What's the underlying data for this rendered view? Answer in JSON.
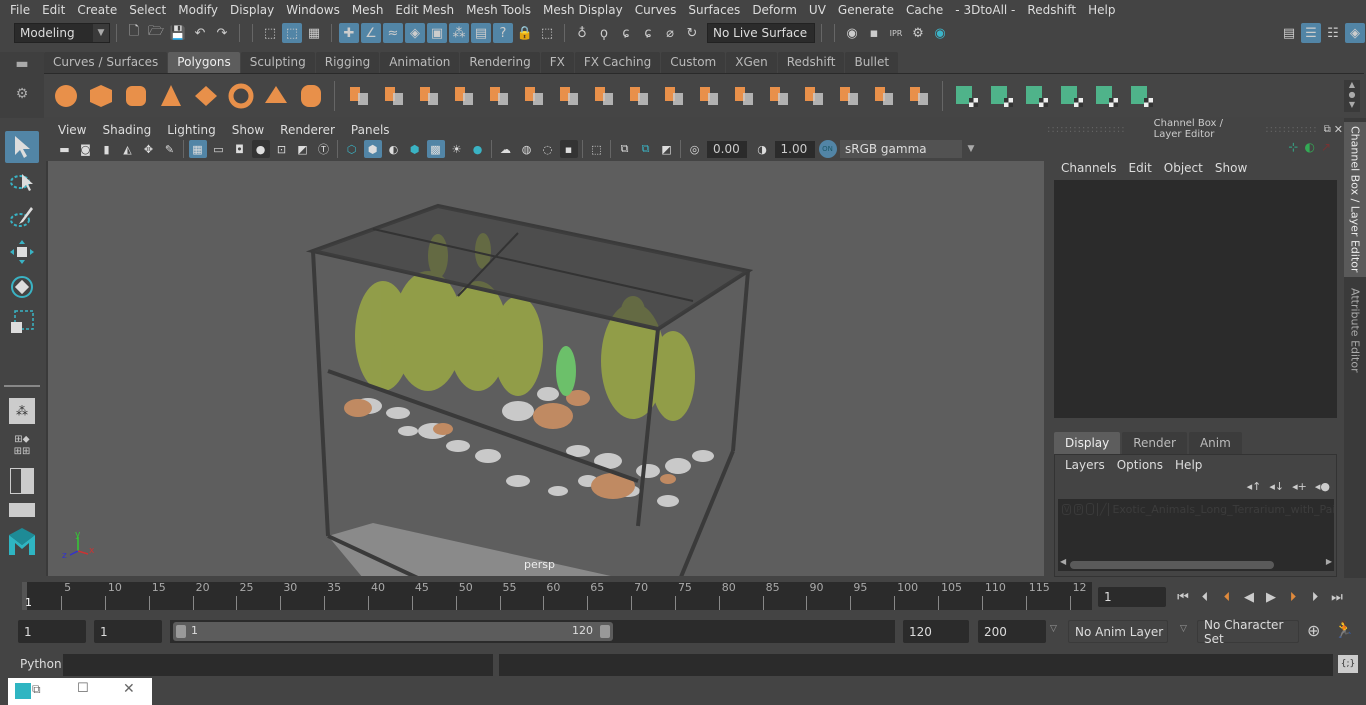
{
  "menubar": {
    "items": [
      "File",
      "Edit",
      "Create",
      "Select",
      "Modify",
      "Display",
      "Windows",
      "Mesh",
      "Edit Mesh",
      "Mesh Tools",
      "Mesh Display",
      "Curves",
      "Surfaces",
      "Deform",
      "UV",
      "Generate",
      "Cache",
      "- 3DtoAll -",
      "Redshift",
      "Help"
    ]
  },
  "statusline": {
    "mode": "Modeling",
    "live_surface": "No Live Surface"
  },
  "shelf": {
    "tabs": [
      "Curves / Surfaces",
      "Polygons",
      "Sculpting",
      "Rigging",
      "Animation",
      "Rendering",
      "FX",
      "FX Caching",
      "Custom",
      "XGen",
      "Redshift",
      "Bullet"
    ],
    "active_tab": "Polygons",
    "icons": [
      "poly-sphere",
      "poly-cube",
      "poly-cylinder",
      "poly-cone",
      "poly-plane",
      "poly-torus",
      "poly-pyramid",
      "poly-pipe",
      "combine",
      "separate",
      "mirror",
      "smooth",
      "extract",
      "boolean",
      "multi-cut",
      "extrude",
      "bevel",
      "bridge",
      "append",
      "insert-edge-loop",
      "offset-edge-loop",
      "fill-hole",
      "target-weld",
      "reduce",
      "planar-uv",
      "cylindrical-uv",
      "spherical-uv",
      "automatic-uv",
      "unfold-uv",
      "uv-editor",
      "layout-uv"
    ]
  },
  "viewport": {
    "menu": [
      "View",
      "Shading",
      "Lighting",
      "Show",
      "Renderer",
      "Panels"
    ],
    "exposure": "0.00",
    "gamma": "1.00",
    "color_space": "sRGB gamma",
    "camera_label": "persp",
    "axis": {
      "x": "x",
      "y": "y",
      "z": "z"
    }
  },
  "channel_box": {
    "title": "Channel Box / Layer Editor",
    "menu": [
      "Channels",
      "Edit",
      "Object",
      "Show"
    ]
  },
  "layer_editor": {
    "tabs": [
      "Display",
      "Render",
      "Anim"
    ],
    "active_tab": "Display",
    "menu": [
      "Layers",
      "Options",
      "Help"
    ],
    "layers": [
      {
        "v": "V",
        "p": "P",
        "name": "Exotic_Animals_Long_Terrarium_with_Pair_o"
      }
    ]
  },
  "side_tabs": [
    "Channel Box / Layer Editor",
    "Attribute Editor"
  ],
  "timeline": {
    "ticks": [
      "5",
      "10",
      "15",
      "20",
      "25",
      "30",
      "35",
      "40",
      "45",
      "50",
      "55",
      "60",
      "65",
      "70",
      "75",
      "80",
      "85",
      "90",
      "95",
      "100",
      "105",
      "110",
      "115",
      "12"
    ],
    "current_frame_marker": "1",
    "current_frame": "1"
  },
  "range": {
    "start": "1",
    "playback_start": "1",
    "slider_start": "1",
    "slider_end": "120",
    "playback_end": "120",
    "end": "200",
    "anim_layer": "No Anim Layer",
    "character_set": "No Character Set"
  },
  "command_line": {
    "label": "Python"
  }
}
